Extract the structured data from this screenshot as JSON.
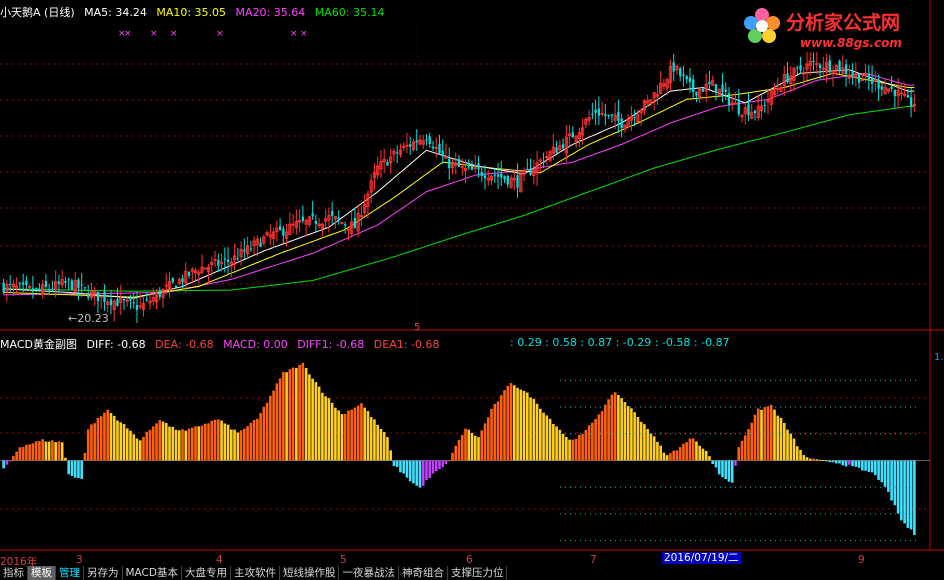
{
  "upper": {
    "title": "小天鹅A (日线)",
    "ma5_label": "MA5: 34.24",
    "ma10_label": "MA10: 35.05",
    "ma20_label": "MA20: 35.64",
    "ma60_label": "MA60: 35.14",
    "low_marker": "←20.23",
    "cross_label": "5"
  },
  "lower": {
    "title": "MACD黄金副图",
    "diff_label": "DIFF: -0.68",
    "dea_label": "DEA: -0.68",
    "macd_label": "MACD: 0.00",
    "diff1_label": "DIFF1: -0.68",
    "dea1_label": "DEA1: -0.68",
    "level_values": ": 0.29 : 0.58 : 0.87 : -0.29 : -0.58 : -0.87",
    "axis_right": "1."
  },
  "xaxis": {
    "labels": [
      "2016年",
      "3",
      "4",
      "5",
      "6",
      "7",
      "8",
      "9"
    ],
    "cursor_date": "2016/07/19/二"
  },
  "logo": {
    "title": "分析家公式网",
    "url": "www.88gs.com"
  },
  "tabs": [
    {
      "label": "指标",
      "active": false,
      "hl": false
    },
    {
      "label": "模板",
      "active": true,
      "hl": false
    },
    {
      "label": "管理",
      "active": false,
      "hl": true
    },
    {
      "label": "另存为",
      "active": false,
      "hl": false
    },
    {
      "label": "MACD基本",
      "active": false,
      "hl": false
    },
    {
      "label": "大盘专用",
      "active": false,
      "hl": false
    },
    {
      "label": "主攻软件",
      "active": false,
      "hl": false
    },
    {
      "label": "短线操作股",
      "active": false,
      "hl": false
    },
    {
      "label": "一夜暴战法",
      "active": false,
      "hl": false
    },
    {
      "label": "神奇组合",
      "active": false,
      "hl": false
    },
    {
      "label": "支撑压力位",
      "active": false,
      "hl": false
    }
  ],
  "colors": {
    "up": "#ff3232",
    "down": "#00e0e0",
    "ma5": "#ffffff",
    "ma10": "#ffff00",
    "ma20": "#ff40ff",
    "ma60": "#00e000",
    "grid": "#a00000",
    "hist_orange": "#ff6010",
    "hist_yellow": "#ffd020",
    "hist_cyan": "#40e0ff",
    "hist_magenta": "#c040ff"
  },
  "chart_data": {
    "type": "candlestick",
    "price_range": [
      19.0,
      44.5
    ],
    "macd_range": [
      -0.95,
      1.2
    ],
    "price_path": [
      [
        0,
        22.0
      ],
      [
        10,
        21.6
      ],
      [
        20,
        22.3
      ],
      [
        28,
        21.2
      ],
      [
        38,
        20.5
      ],
      [
        42,
        20.23
      ],
      [
        50,
        21.8
      ],
      [
        60,
        23.5
      ],
      [
        70,
        24.2
      ],
      [
        80,
        26.0
      ],
      [
        90,
        27.2
      ],
      [
        100,
        27.8
      ],
      [
        108,
        27.0
      ],
      [
        115,
        32.0
      ],
      [
        122,
        33.5
      ],
      [
        130,
        34.8
      ],
      [
        136,
        32.5
      ],
      [
        142,
        31.8
      ],
      [
        150,
        31.5
      ],
      [
        158,
        30.8
      ],
      [
        166,
        32.8
      ],
      [
        174,
        34.5
      ],
      [
        182,
        36.8
      ],
      [
        190,
        35.8
      ],
      [
        198,
        37.5
      ],
      [
        206,
        40.5
      ],
      [
        212,
        38.5
      ],
      [
        218,
        39.0
      ],
      [
        226,
        37.0
      ],
      [
        232,
        36.8
      ],
      [
        240,
        39.5
      ],
      [
        248,
        40.8
      ],
      [
        256,
        40.6
      ],
      [
        262,
        39.8
      ],
      [
        268,
        39.2
      ],
      [
        274,
        38.5
      ],
      [
        278,
        37.5
      ]
    ],
    "ma5_path": [
      [
        0,
        21.8
      ],
      [
        20,
        21.5
      ],
      [
        40,
        21.0
      ],
      [
        55,
        22.0
      ],
      [
        80,
        25.0
      ],
      [
        100,
        27.0
      ],
      [
        115,
        30.0
      ],
      [
        130,
        33.5
      ],
      [
        145,
        32.2
      ],
      [
        160,
        31.5
      ],
      [
        175,
        34.0
      ],
      [
        190,
        35.8
      ],
      [
        205,
        38.5
      ],
      [
        215,
        38.8
      ],
      [
        228,
        37.5
      ],
      [
        245,
        40.0
      ],
      [
        260,
        40.3
      ],
      [
        278,
        38.5
      ]
    ],
    "ma10_path": [
      [
        0,
        21.5
      ],
      [
        20,
        21.3
      ],
      [
        40,
        21.1
      ],
      [
        60,
        22.0
      ],
      [
        85,
        24.8
      ],
      [
        105,
        26.8
      ],
      [
        120,
        29.5
      ],
      [
        135,
        32.5
      ],
      [
        150,
        32.0
      ],
      [
        165,
        31.6
      ],
      [
        180,
        34.0
      ],
      [
        195,
        35.8
      ],
      [
        210,
        37.8
      ],
      [
        225,
        38.2
      ],
      [
        240,
        38.8
      ],
      [
        255,
        40.0
      ],
      [
        278,
        38.8
      ]
    ],
    "ma20_path": [
      [
        0,
        21.3
      ],
      [
        30,
        21.4
      ],
      [
        50,
        21.5
      ],
      [
        70,
        22.6
      ],
      [
        95,
        24.8
      ],
      [
        115,
        27.2
      ],
      [
        130,
        30.0
      ],
      [
        145,
        31.4
      ],
      [
        160,
        31.8
      ],
      [
        175,
        32.5
      ],
      [
        190,
        34.0
      ],
      [
        205,
        35.8
      ],
      [
        220,
        37.2
      ],
      [
        235,
        37.8
      ],
      [
        250,
        39.4
      ],
      [
        265,
        40.0
      ],
      [
        278,
        39.0
      ]
    ],
    "ma60_path": [
      [
        0,
        21.8
      ],
      [
        40,
        21.6
      ],
      [
        70,
        21.7
      ],
      [
        95,
        22.5
      ],
      [
        120,
        24.5
      ],
      [
        140,
        26.3
      ],
      [
        160,
        28.0
      ],
      [
        180,
        30.0
      ],
      [
        200,
        32.0
      ],
      [
        220,
        33.6
      ],
      [
        240,
        35.0
      ],
      [
        260,
        36.5
      ],
      [
        278,
        37.2
      ]
    ],
    "hist_path": [
      [
        0,
        -0.1
      ],
      [
        5,
        0.15
      ],
      [
        12,
        0.22
      ],
      [
        18,
        0.2
      ],
      [
        20,
        -0.15
      ],
      [
        24,
        -0.2
      ],
      [
        26,
        0.35
      ],
      [
        32,
        0.55
      ],
      [
        38,
        0.35
      ],
      [
        42,
        0.22
      ],
      [
        48,
        0.45
      ],
      [
        52,
        0.35
      ],
      [
        56,
        0.32
      ],
      [
        62,
        0.4
      ],
      [
        66,
        0.45
      ],
      [
        72,
        0.3
      ],
      [
        78,
        0.45
      ],
      [
        86,
        0.95
      ],
      [
        92,
        1.05
      ],
      [
        98,
        0.75
      ],
      [
        104,
        0.5
      ],
      [
        110,
        0.62
      ],
      [
        118,
        0.25
      ],
      [
        120,
        -0.05
      ],
      [
        126,
        -0.25
      ],
      [
        128,
        -0.3
      ],
      [
        132,
        -0.15
      ],
      [
        136,
        -0.05
      ],
      [
        142,
        0.35
      ],
      [
        146,
        0.25
      ],
      [
        150,
        0.55
      ],
      [
        156,
        0.85
      ],
      [
        162,
        0.7
      ],
      [
        168,
        0.45
      ],
      [
        174,
        0.22
      ],
      [
        178,
        0.28
      ],
      [
        184,
        0.55
      ],
      [
        188,
        0.75
      ],
      [
        192,
        0.6
      ],
      [
        198,
        0.35
      ],
      [
        204,
        0.05
      ],
      [
        208,
        0.15
      ],
      [
        212,
        0.25
      ],
      [
        216,
        0.1
      ],
      [
        220,
        -0.15
      ],
      [
        224,
        -0.25
      ],
      [
        226,
        0.15
      ],
      [
        232,
        0.55
      ],
      [
        236,
        0.6
      ],
      [
        240,
        0.4
      ],
      [
        246,
        0.05
      ],
      [
        250,
        0.0
      ],
      [
        256,
        -0.02
      ],
      [
        262,
        -0.08
      ],
      [
        268,
        -0.15
      ],
      [
        272,
        -0.35
      ],
      [
        276,
        -0.65
      ],
      [
        280,
        -0.8
      ]
    ],
    "macd_levels": [
      0.29,
      0.58,
      0.87,
      -0.29,
      -0.58,
      -0.87
    ]
  }
}
